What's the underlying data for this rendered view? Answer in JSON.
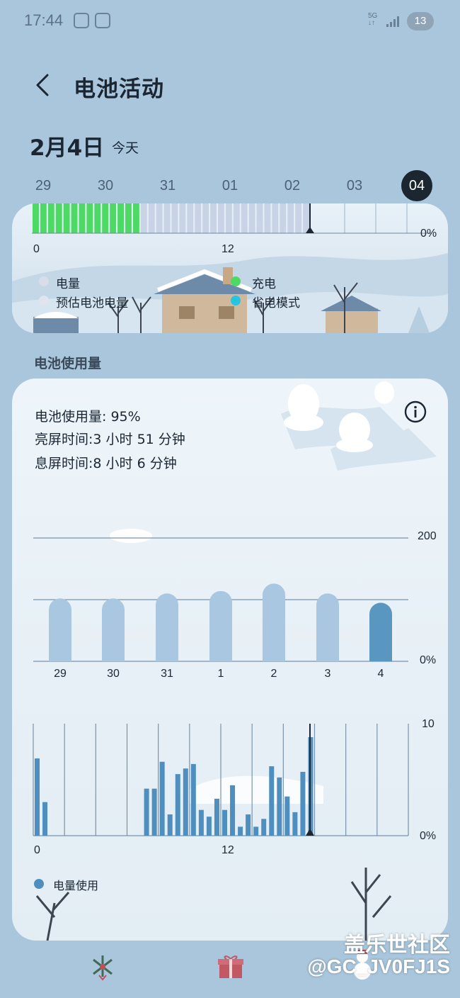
{
  "status_bar": {
    "time": "17:44",
    "network": "5G",
    "battery_level": "13"
  },
  "header": {
    "title": "电池活动",
    "back_icon": "chevron-left-icon"
  },
  "date": {
    "main": "2月4日",
    "sub": "今天"
  },
  "days": [
    "29",
    "30",
    "31",
    "01",
    "02",
    "03",
    "04"
  ],
  "selected_day": "04",
  "battery_timeline": {
    "x_labels": [
      "0",
      "12"
    ],
    "y_label": "0%",
    "legend": [
      {
        "label": "电量",
        "color": "#d7dde9"
      },
      {
        "label": "预估电池电量",
        "color": "#dfe4ee"
      },
      {
        "label": "充电",
        "color": "#4cd964"
      },
      {
        "label": "省电模式",
        "color": "#27c4e0"
      }
    ]
  },
  "section": {
    "usage_title": "电池使用量"
  },
  "usage_summary": {
    "usage": "电池使用量:  95%",
    "screen_on": "亮屏时间:3 小时 51 分钟",
    "screen_off": "息屏时间:8 小时 6 分钟"
  },
  "colors": {
    "bar_past": "#a9c7e0",
    "bar_today": "#5a97c0",
    "hourly_bar": "#4f8fbf",
    "charge_green": "#4cd964",
    "level_bar": "#c9d3e6"
  },
  "chart_data": [
    {
      "type": "bar",
      "categories": [
        "29",
        "30",
        "31",
        "1",
        "2",
        "3",
        "4"
      ],
      "values": [
        102,
        102,
        110,
        114,
        126,
        110,
        95
      ],
      "y_tick_labels": [
        "200",
        "0%"
      ],
      "ylim": [
        0,
        200
      ],
      "grid": true
    },
    {
      "type": "bar",
      "x": [
        0,
        0.5,
        1,
        1.5,
        2,
        2.5,
        3,
        3.5,
        4,
        4.5,
        5,
        5.5,
        6,
        6.5,
        7,
        7.5,
        8,
        8.5,
        9,
        9.5,
        10,
        10.5,
        11,
        11.5,
        12,
        12.5,
        13,
        13.5,
        14,
        14.5,
        15,
        15.5,
        16,
        16.5,
        17,
        17.5
      ],
      "values": [
        6.9,
        3.0,
        0,
        0,
        0,
        0,
        0,
        0,
        0,
        0,
        0,
        0,
        0,
        0,
        4.2,
        4.2,
        6.6,
        1.9,
        5.5,
        6.0,
        6.4,
        2.3,
        1.7,
        3.3,
        2.3,
        4.5,
        0.8,
        1.9,
        0.8,
        1.5,
        6.2,
        5.2,
        3.5,
        2.1,
        5.7,
        8.8
      ],
      "x_tick_labels": [
        "0",
        "12"
      ],
      "y_tick_labels": [
        "10",
        "0%"
      ],
      "ylim": [
        0,
        10
      ],
      "legend": [
        "电量使用"
      ],
      "grid": true
    }
  ],
  "bottom_nav": {
    "items": [
      "christmas-wreath-icon",
      "gift-icon",
      "snowman-icon"
    ]
  },
  "watermark": {
    "line1": "盖乐世社区",
    "line2": "@GC_JV0FJ1S"
  }
}
